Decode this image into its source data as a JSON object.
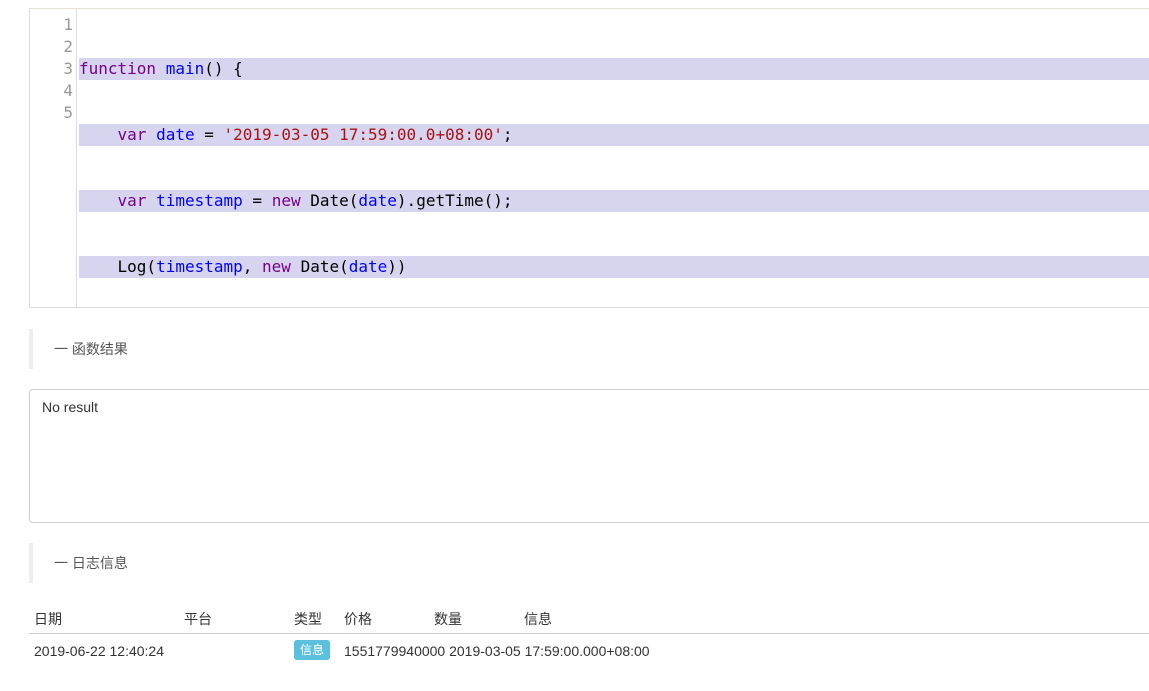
{
  "editor": {
    "line_numbers": [
      "1",
      "2",
      "3",
      "4",
      "5"
    ],
    "lines": [
      [
        {
          "t": "function",
          "c": "kw"
        },
        {
          "t": " ",
          "c": ""
        },
        {
          "t": "main",
          "c": "def"
        },
        {
          "t": "() {",
          "c": ""
        }
      ],
      [
        {
          "t": "    ",
          "c": ""
        },
        {
          "t": "var",
          "c": "kw"
        },
        {
          "t": " ",
          "c": ""
        },
        {
          "t": "date",
          "c": "def"
        },
        {
          "t": " = ",
          "c": ""
        },
        {
          "t": "'2019-03-05 17:59:00.0+08:00'",
          "c": "str"
        },
        {
          "t": ";",
          "c": ""
        }
      ],
      [
        {
          "t": "    ",
          "c": ""
        },
        {
          "t": "var",
          "c": "kw"
        },
        {
          "t": " ",
          "c": ""
        },
        {
          "t": "timestamp",
          "c": "def"
        },
        {
          "t": " = ",
          "c": ""
        },
        {
          "t": "new",
          "c": "kw"
        },
        {
          "t": " Date(",
          "c": ""
        },
        {
          "t": "date",
          "c": "var"
        },
        {
          "t": ").getTime();",
          "c": ""
        }
      ],
      [
        {
          "t": "    Log(",
          "c": ""
        },
        {
          "t": "timestamp",
          "c": "var"
        },
        {
          "t": ", ",
          "c": ""
        },
        {
          "t": "new",
          "c": "kw"
        },
        {
          "t": " Date(",
          "c": ""
        },
        {
          "t": "date",
          "c": "var"
        },
        {
          "t": "))",
          "c": ""
        }
      ],
      [
        {
          "t": "}",
          "c": ""
        }
      ]
    ]
  },
  "result_section": {
    "title": "一 函数结果"
  },
  "result_box": {
    "text": "No result"
  },
  "log_section": {
    "title": "一 日志信息"
  },
  "log_table": {
    "headers": [
      "日期",
      "平台",
      "类型",
      "价格",
      "数量",
      "信息"
    ],
    "rows": [
      {
        "date": "2019-06-22 12:40:24",
        "platform": "",
        "type": "信息",
        "info": "1551779940000 2019-03-05 17:59:00.000+08:00"
      }
    ]
  },
  "colors": {
    "badge": "#5bc0de",
    "selection": "#d7d4f0",
    "keyword": "#770088",
    "definition": "#0000ff",
    "string": "#aa1111"
  }
}
